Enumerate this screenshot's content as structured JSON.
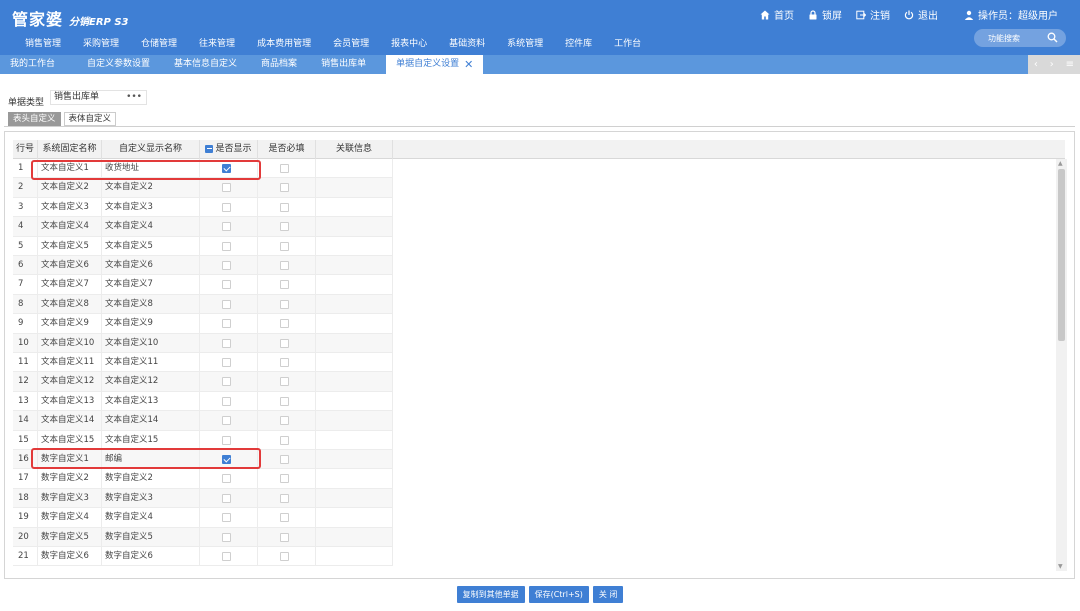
{
  "header": {
    "logo_main": "管家婆",
    "logo_sub": "分销ERP S3",
    "nav": {
      "home": "首页",
      "lock": "锁屏",
      "logout": "注销",
      "exit": "退出",
      "user": "操作员：超级用户"
    },
    "menu": [
      "销售管理",
      "采购管理",
      "仓储管理",
      "往来管理",
      "成本费用管理",
      "会员管理",
      "报表中心",
      "基础资料",
      "系统管理",
      "控件库",
      "工作台"
    ],
    "function_search": "功能搜索"
  },
  "tabs": [
    "我的工作台",
    "自定义参数设置",
    "基本信息自定义",
    "商品档案",
    "销售出库单",
    "单据自定义设置"
  ],
  "active_tab": "单据自定义设置",
  "doc_type_label": "单据类型",
  "doc_type_value": "销售出库单",
  "doc_type_dots": "•••",
  "subtabs": [
    "表头自定义",
    "表体自定义"
  ],
  "columns": {
    "no": "行号",
    "sys": "系统固定名称",
    "disp": "自定义显示名称",
    "show": "是否显示",
    "req": "是否必填",
    "rel": "关联信息"
  },
  "rows": [
    {
      "no": "1",
      "sys": "文本自定义1",
      "disp": "收货地址",
      "show": true,
      "req": false
    },
    {
      "no": "2",
      "sys": "文本自定义2",
      "disp": "文本自定义2",
      "show": false,
      "req": false
    },
    {
      "no": "3",
      "sys": "文本自定义3",
      "disp": "文本自定义3",
      "show": false,
      "req": false
    },
    {
      "no": "4",
      "sys": "文本自定义4",
      "disp": "文本自定义4",
      "show": false,
      "req": false
    },
    {
      "no": "5",
      "sys": "文本自定义5",
      "disp": "文本自定义5",
      "show": false,
      "req": false
    },
    {
      "no": "6",
      "sys": "文本自定义6",
      "disp": "文本自定义6",
      "show": false,
      "req": false
    },
    {
      "no": "7",
      "sys": "文本自定义7",
      "disp": "文本自定义7",
      "show": false,
      "req": false
    },
    {
      "no": "8",
      "sys": "文本自定义8",
      "disp": "文本自定义8",
      "show": false,
      "req": false
    },
    {
      "no": "9",
      "sys": "文本自定义9",
      "disp": "文本自定义9",
      "show": false,
      "req": false
    },
    {
      "no": "10",
      "sys": "文本自定义10",
      "disp": "文本自定义10",
      "show": false,
      "req": false
    },
    {
      "no": "11",
      "sys": "文本自定义11",
      "disp": "文本自定义11",
      "show": false,
      "req": false
    },
    {
      "no": "12",
      "sys": "文本自定义12",
      "disp": "文本自定义12",
      "show": false,
      "req": false
    },
    {
      "no": "13",
      "sys": "文本自定义13",
      "disp": "文本自定义13",
      "show": false,
      "req": false
    },
    {
      "no": "14",
      "sys": "文本自定义14",
      "disp": "文本自定义14",
      "show": false,
      "req": false
    },
    {
      "no": "15",
      "sys": "文本自定义15",
      "disp": "文本自定义15",
      "show": false,
      "req": false
    },
    {
      "no": "16",
      "sys": "数字自定义1",
      "disp": "邮编",
      "show": true,
      "req": false
    },
    {
      "no": "17",
      "sys": "数字自定义2",
      "disp": "数字自定义2",
      "show": false,
      "req": false
    },
    {
      "no": "18",
      "sys": "数字自定义3",
      "disp": "数字自定义3",
      "show": false,
      "req": false
    },
    {
      "no": "19",
      "sys": "数字自定义4",
      "disp": "数字自定义4",
      "show": false,
      "req": false
    },
    {
      "no": "20",
      "sys": "数字自定义5",
      "disp": "数字自定义5",
      "show": false,
      "req": false
    },
    {
      "no": "21",
      "sys": "数字自定义6",
      "disp": "数字自定义6",
      "show": false,
      "req": false
    }
  ],
  "highlighted_rows": [
    "1",
    "16"
  ],
  "buttons": {
    "copy": "复制到其他单据",
    "save": "保存(Ctrl+S)",
    "close": "关 闭"
  },
  "colors": {
    "header_bg": "#3f7fd4",
    "tab_strip": "#5b97dd",
    "highlight": "#e23a3a"
  }
}
